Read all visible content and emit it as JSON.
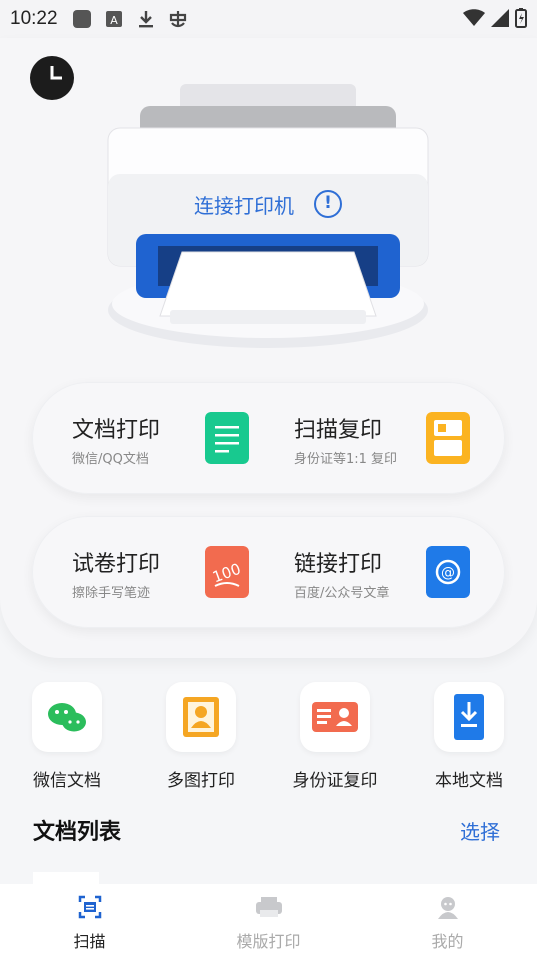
{
  "status_bar": {
    "time": "10:22",
    "left_icons": [
      "notification-square-icon",
      "font-a-icon",
      "download-icon",
      "bug-icon"
    ],
    "right_icons": [
      "wifi-icon",
      "signal-icon",
      "battery-charging-icon"
    ]
  },
  "header": {
    "history_icon": "clock-icon",
    "connect_label": "连接打印机",
    "connect_info_icon": "info-icon",
    "connect_info_glyph": "!"
  },
  "features": [
    {
      "title": "文档打印",
      "subtitle": "微信/QQ文档",
      "icon": "document-icon",
      "color": "#18c98f"
    },
    {
      "title": "扫描复印",
      "subtitle": "身份证等1:1 复印",
      "icon": "scan-copy-icon",
      "color": "#fbb321"
    },
    {
      "title": "试卷打印",
      "subtitle": "擦除手写笔迹",
      "icon": "exam-score-icon",
      "color": "#f26b4f"
    },
    {
      "title": "链接打印",
      "subtitle": "百度/公众号文章",
      "icon": "link-at-icon",
      "color": "#1f7ae8"
    }
  ],
  "tools": [
    {
      "label": "微信文档",
      "icon": "wechat-icon"
    },
    {
      "label": "多图打印",
      "icon": "photo-portrait-icon"
    },
    {
      "label": "身份证复印",
      "icon": "id-card-icon"
    },
    {
      "label": "本地文档",
      "icon": "local-download-icon"
    }
  ],
  "doc_list": {
    "title": "文档列表",
    "select_label": "选择"
  },
  "bottom_nav": [
    {
      "label": "扫描",
      "icon": "scan-icon",
      "active": true
    },
    {
      "label": "模版打印",
      "icon": "printer-icon",
      "active": false
    },
    {
      "label": "我的",
      "icon": "profile-icon",
      "active": false
    }
  ],
  "colors": {
    "accent": "#2f6fd6",
    "printer_blue": "#1f63d0"
  }
}
